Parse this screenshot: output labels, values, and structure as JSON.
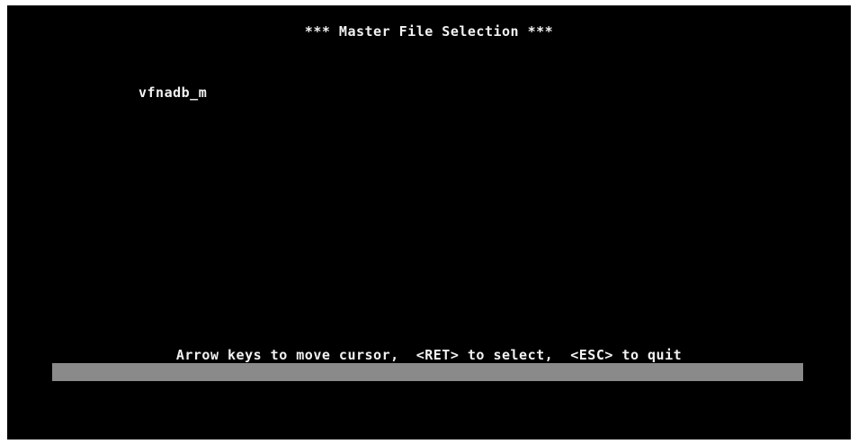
{
  "header": {
    "title": "*** Master File Selection ***"
  },
  "file_list": {
    "items": [
      "vfnadb_m"
    ]
  },
  "footer": {
    "instructions": "Arrow keys to move cursor,  <RET> to select,  <ESC> to quit"
  },
  "colors": {
    "background": "#000000",
    "text": "#f2f2f2",
    "status_bar": "#8a8a8a"
  }
}
